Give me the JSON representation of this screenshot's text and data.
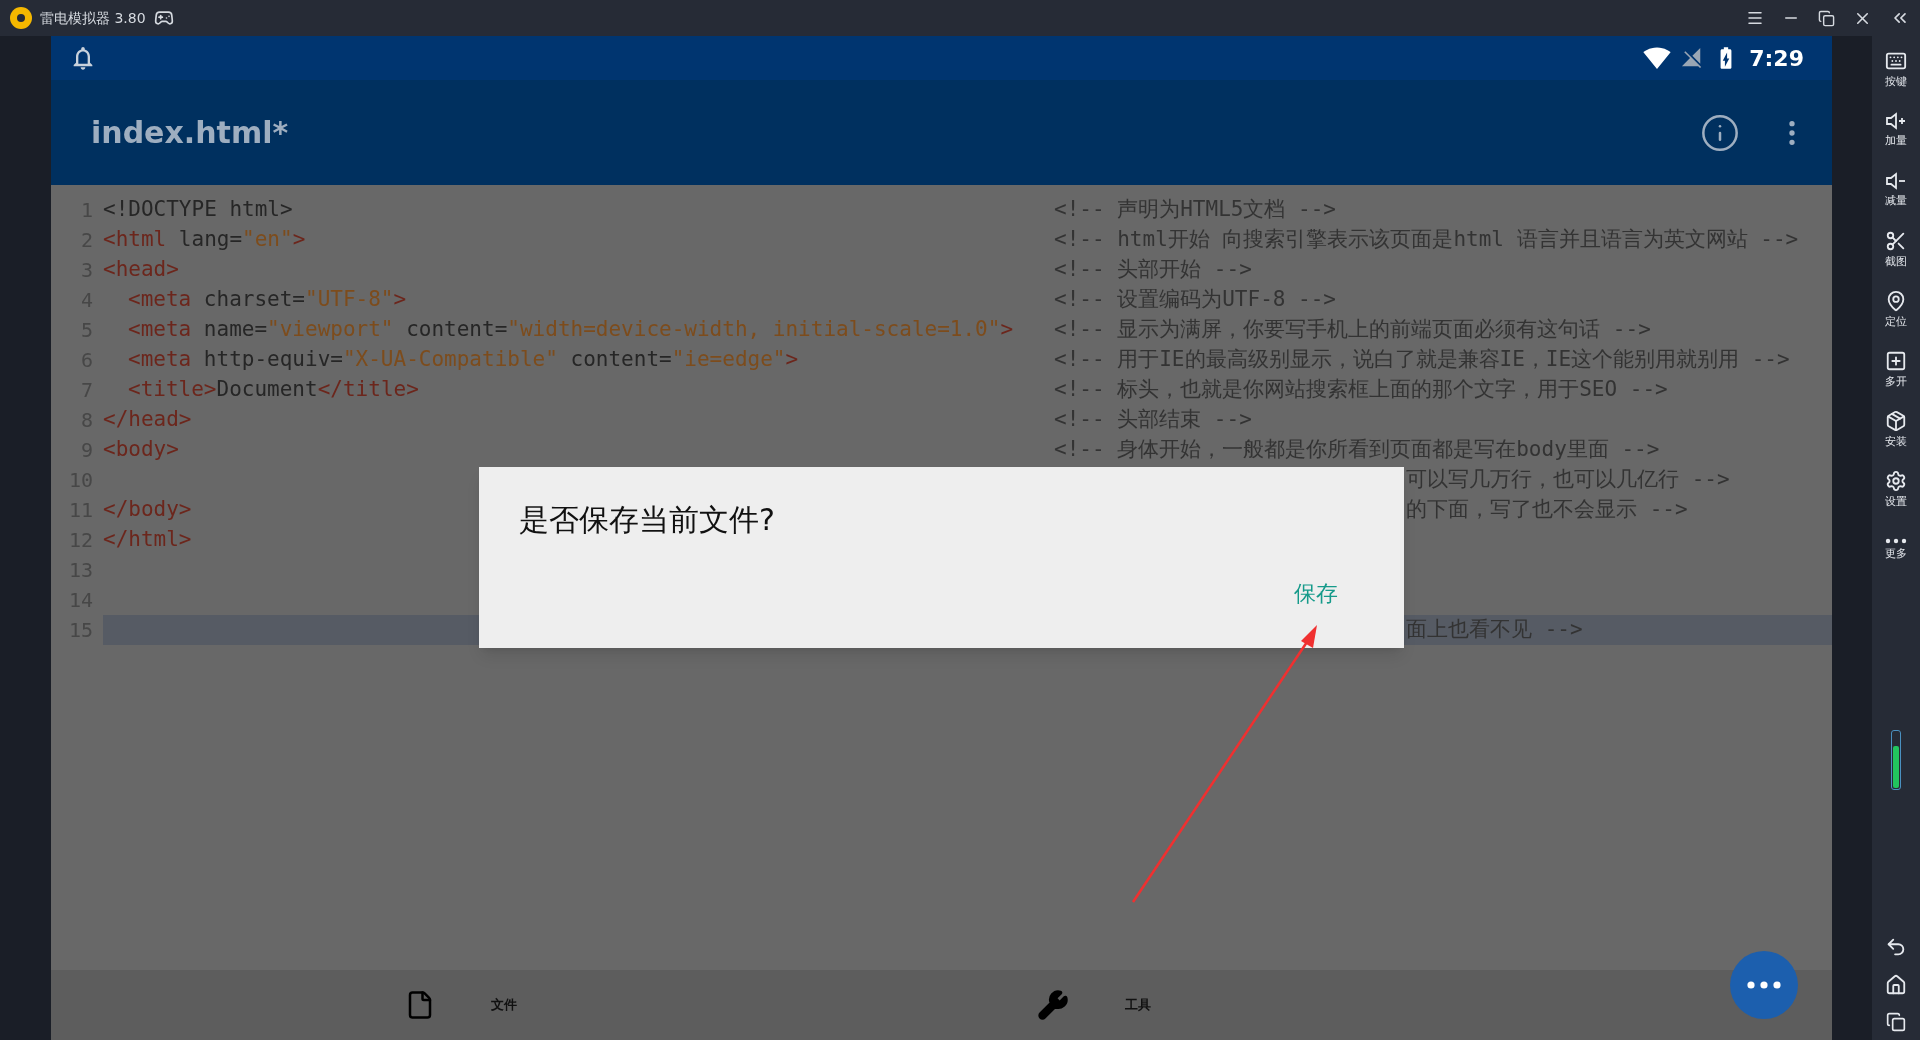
{
  "emulator": {
    "title": "雷电模拟器 3.80"
  },
  "status_bar": {
    "time": "7:29"
  },
  "app_bar": {
    "title": "index.html*"
  },
  "editor": {
    "lines": [
      {
        "number": "1",
        "indented": false,
        "current": false,
        "tokens": [
          {
            "kind": "plain",
            "text": "<!DOCTYPE html>"
          }
        ],
        "comment": {
          "kind": "full",
          "text": "<!-- 声明为HTML5文档 -->"
        }
      },
      {
        "number": "2",
        "indented": false,
        "current": false,
        "tokens": [
          {
            "kind": "tag",
            "text": "<html"
          },
          {
            "kind": "plain",
            "text": " lang="
          },
          {
            "kind": "string",
            "text": "\"en\""
          },
          {
            "kind": "tag",
            "text": ">"
          }
        ],
        "comment": {
          "kind": "full",
          "text": "<!-- html开始 向搜索引擎表示该页面是html 语言并且语言为英文网站 -->"
        }
      },
      {
        "number": "3",
        "indented": false,
        "current": false,
        "tokens": [
          {
            "kind": "tag",
            "text": "<head>"
          }
        ],
        "comment": {
          "kind": "full",
          "text": "<!-- 头部开始 -->"
        }
      },
      {
        "number": "4",
        "indented": true,
        "current": false,
        "tokens": [
          {
            "kind": "tag",
            "text": "<meta"
          },
          {
            "kind": "plain",
            "text": " charset="
          },
          {
            "kind": "string",
            "text": "\"UTF-8\""
          },
          {
            "kind": "tag",
            "text": ">"
          }
        ],
        "comment": {
          "kind": "full",
          "text": "<!-- 设置编码为UTF-8 -->"
        }
      },
      {
        "number": "5",
        "indented": true,
        "current": false,
        "tokens": [
          {
            "kind": "tag",
            "text": "<meta"
          },
          {
            "kind": "plain",
            "text": " name="
          },
          {
            "kind": "string",
            "text": "\"viewport\""
          },
          {
            "kind": "plain",
            "text": " content="
          },
          {
            "kind": "string",
            "text": "\"width=device-width, initial-scale=1.0\""
          },
          {
            "kind": "tag",
            "text": ">"
          }
        ],
        "comment": {
          "kind": "full",
          "text": "<!-- 显示为满屏，你要写手机上的前端页面必须有这句话 -->"
        }
      },
      {
        "number": "6",
        "indented": true,
        "current": false,
        "tokens": [
          {
            "kind": "tag",
            "text": "<meta"
          },
          {
            "kind": "plain",
            "text": " http-equiv="
          },
          {
            "kind": "string",
            "text": "\"X-UA-Compatible\""
          },
          {
            "kind": "plain",
            "text": " content="
          },
          {
            "kind": "string",
            "text": "\"ie=edge\""
          },
          {
            "kind": "tag",
            "text": ">"
          }
        ],
        "comment": {
          "kind": "full",
          "text": "<!-- 用于IE的最高级别显示，说白了就是兼容IE，IE这个能别用就别用 -->"
        }
      },
      {
        "number": "7",
        "indented": true,
        "current": false,
        "tokens": [
          {
            "kind": "tag",
            "text": "<title>"
          },
          {
            "kind": "plain",
            "text": "Document"
          },
          {
            "kind": "tag",
            "text": "</title>"
          }
        ],
        "comment": {
          "kind": "full",
          "text": "<!-- 标头，也就是你网站搜索框上面的那个文字，用于SEO -->"
        }
      },
      {
        "number": "8",
        "indented": false,
        "current": false,
        "tokens": [
          {
            "kind": "tag",
            "text": "</head>"
          }
        ],
        "comment": {
          "kind": "full",
          "text": "<!-- 头部结束 -->"
        }
      },
      {
        "number": "9",
        "indented": false,
        "current": false,
        "tokens": [
          {
            "kind": "tag",
            "text": "<body>"
          }
        ],
        "comment": {
          "kind": "full",
          "text": "<!-- 身体开始，一般都是你所看到页面都是写在body里面 -->"
        }
      },
      {
        "number": "10",
        "current": false,
        "comment": {
          "kind": "partial",
          "text": "可以写几万行，也可以几亿行 -->"
        }
      },
      {
        "number": "11",
        "indented": false,
        "current": false,
        "tokens": [
          {
            "kind": "tag",
            "text": "</body>"
          }
        ],
        "comment": {
          "kind": "partial",
          "text": "的下面，写了也不会显示 -->"
        }
      },
      {
        "number": "12",
        "indented": false,
        "current": false,
        "tokens": [
          {
            "kind": "tag",
            "text": "</html>"
          }
        ]
      },
      {
        "number": "13",
        "current": false
      },
      {
        "number": "14",
        "current": false
      },
      {
        "number": "15",
        "current": true,
        "comment": {
          "kind": "partial",
          "text": "面上也看不见 -->"
        }
      }
    ]
  },
  "dialog": {
    "title": "是否保存当前文件?",
    "button": "保存"
  },
  "bottom_bar": {
    "items": [
      {
        "kind": "file",
        "label": "文件"
      },
      {
        "kind": "tools",
        "label": "工具"
      }
    ]
  },
  "sidebar": {
    "items": [
      {
        "kind": "keyboard",
        "label": "按键"
      },
      {
        "kind": "volume-up",
        "label": "加量"
      },
      {
        "kind": "volume-down",
        "label": "减量"
      },
      {
        "kind": "screenshot",
        "label": "截图"
      },
      {
        "kind": "location",
        "label": "定位"
      },
      {
        "kind": "multi",
        "label": "多开"
      },
      {
        "kind": "install",
        "label": "安装"
      },
      {
        "kind": "settings",
        "label": "设置"
      },
      {
        "kind": "more",
        "label": "更多"
      }
    ]
  }
}
